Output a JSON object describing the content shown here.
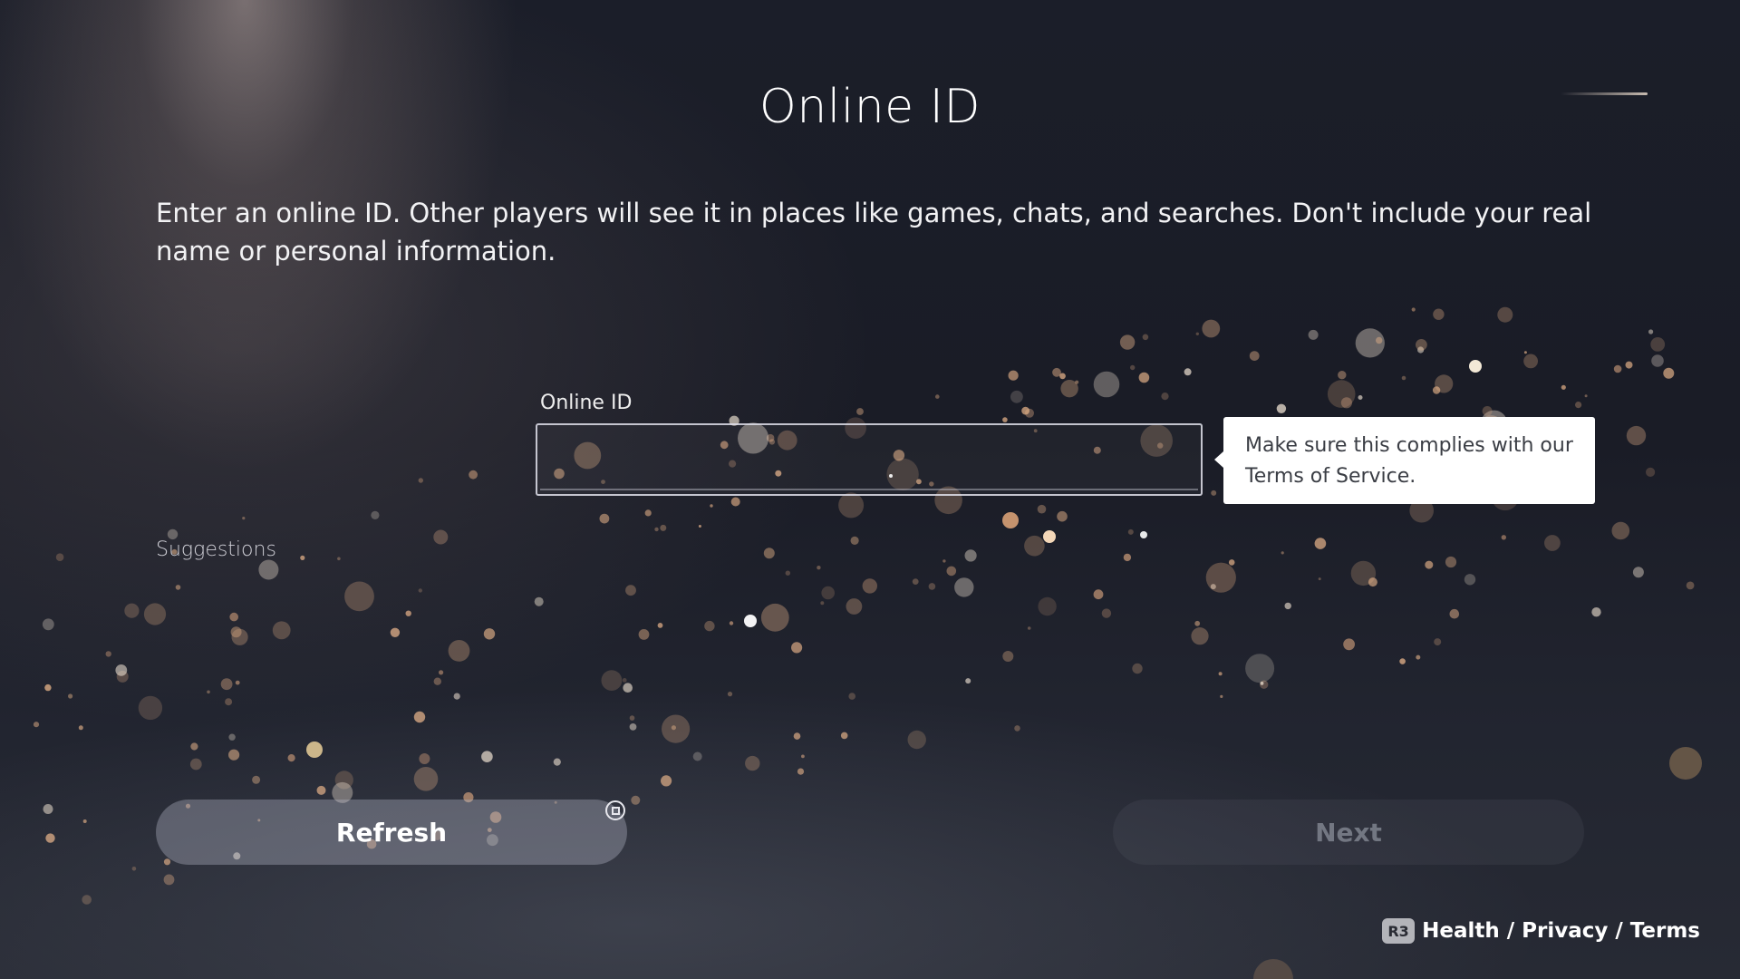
{
  "page": {
    "title": "Online ID",
    "description": "Enter an online ID. Other players will see it in places like games, chats, and searches. Don't include your real name or personal information."
  },
  "form": {
    "field_label": "Online ID",
    "input_value": "",
    "tooltip": "Make sure this complies with our Terms of Service."
  },
  "suggestions": {
    "heading": "Suggestions"
  },
  "buttons": {
    "refresh_label": "Refresh",
    "refresh_shortcut_icon": "square-button-icon",
    "next_label": "Next",
    "next_enabled": false
  },
  "footer": {
    "shortcut_icon": "R3",
    "link_label": "Health / Privacy / Terms"
  },
  "colors": {
    "background": "#1b1e29",
    "tooltip_background": "#ffffff",
    "button_refresh": "#afb4c3"
  }
}
